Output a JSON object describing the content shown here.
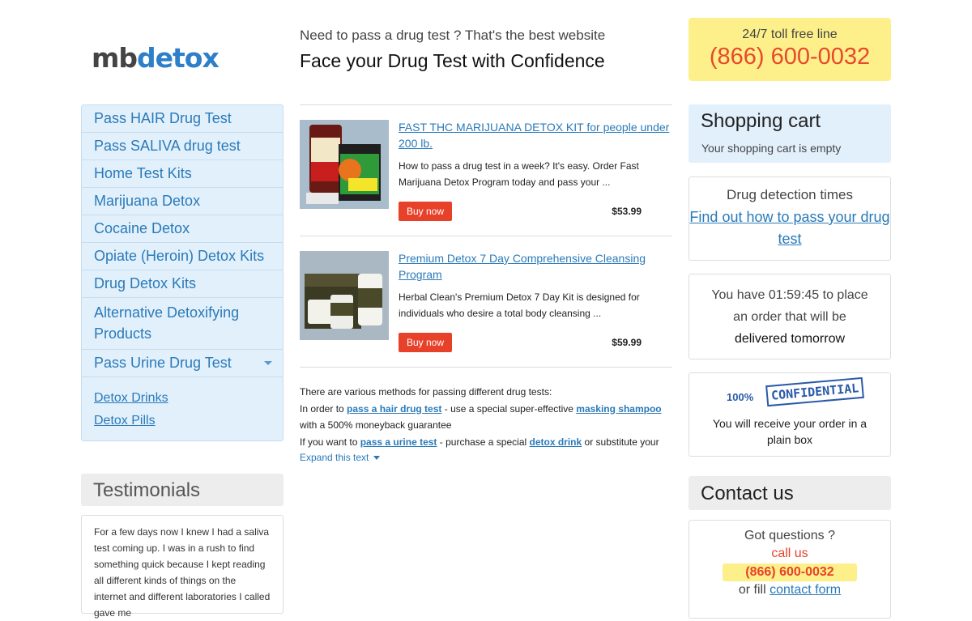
{
  "logo": {
    "part1": "mb",
    "part2": "detox"
  },
  "header": {
    "tagline": "Need to pass a drug test ? That's the best website",
    "headline": "Face your Drug Test with Confidence"
  },
  "phone_box": {
    "label": "24/7 toll free line",
    "number": "(866) 600-0032"
  },
  "nav": {
    "items": [
      "Pass HAIR Drug Test",
      "Pass SALIVA drug test",
      "Home Test Kits",
      "Marijuana Detox",
      "Cocaine Detox",
      "Opiate (Heroin) Detox Kits",
      "Drug Detox Kits",
      "Alternative Detoxifying Products",
      "Pass Urine Drug Test"
    ],
    "sub_items": [
      "Detox Drinks",
      "Detox Pills"
    ]
  },
  "testimonials": {
    "heading": "Testimonials",
    "text": "For a few days now I knew I had a saliva test coming up. I was in a rush to find something quick because I kept reading all different kinds of things on the internet and different laboratories I called gave me"
  },
  "products": [
    {
      "title": "FAST THC MARIJUANA DETOX KIT for people under 200 lb.",
      "description": "How to pass a drug test in a week? It's easy. Order Fast Marijuana Detox Program today and pass your ...",
      "button": "Buy now",
      "price": "$53.99"
    },
    {
      "title": "Premium Detox 7 Day Comprehensive Cleansing Program",
      "description": "Herbal Clean's Premium Detox 7 Day Kit is designed for individuals who desire a total body cleansing ...",
      "button": "Buy now",
      "price": "$59.99"
    }
  ],
  "intro": {
    "line1": "There are various methods for passing different drug tests:",
    "l2a": "In order to ",
    "l2link1": "pass a hair drug test",
    "l2b": " - use a special super-effective ",
    "l2link2": "masking shampoo",
    "l3": "with a 500% moneyback guarantee",
    "l4a": "If you want to ",
    "l4link1": "pass a urine test",
    "l4b": " - purchase a special ",
    "l4link2": "detox drink",
    "l4c": " or substitute your",
    "expand": "Expand this text"
  },
  "cart": {
    "title": "Shopping cart",
    "status": "Your shopping cart is empty"
  },
  "detection": {
    "title": "Drug detection times",
    "link": "Find out how to pass your drug test"
  },
  "timer": {
    "line1": "You have 01:59:45 to place",
    "line2": "an order that will be",
    "line3": "delivered tomorrow"
  },
  "confidential": {
    "percent": "100%",
    "stamp": "CONFIDENTIAL",
    "text": "You will receive your order in a plain box"
  },
  "contact": {
    "heading": "Contact us",
    "questions": "Got questions ?",
    "call": "call us",
    "number": "(866) 600-0032",
    "or_fill": "or fill ",
    "form_link": "contact form"
  },
  "colors": {
    "accent_blue": "#2a7ab8",
    "buy_red": "#e8412a",
    "phone_yellow": "#fdf08a",
    "nav_bg": "#e2f0fc"
  }
}
